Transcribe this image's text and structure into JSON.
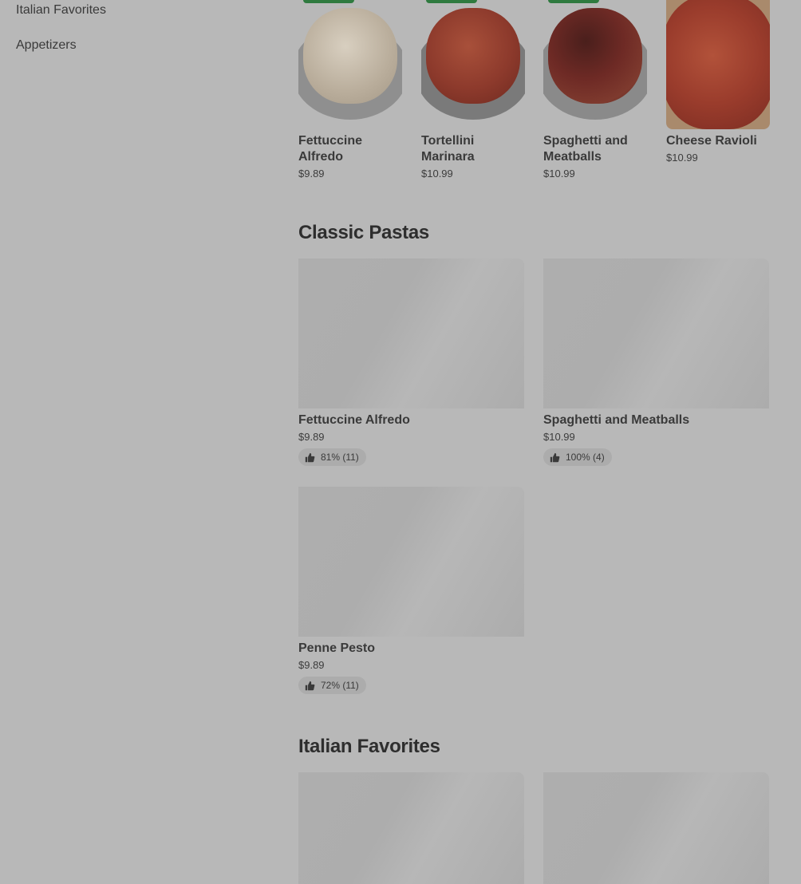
{
  "sidebar": {
    "items": [
      {
        "label": "Italian Favorites"
      },
      {
        "label": "Appetizers"
      }
    ]
  },
  "featured": {
    "items": [
      {
        "name": "Fettuccine Alfredo",
        "price": "$9.89",
        "food_color": "#c9bfb0",
        "plate_color": "#8f8f8f"
      },
      {
        "name": "Tortellini Marinara",
        "price": "$10.99",
        "food_color": "#8d3a2c",
        "plate_color": "#7a7a7a"
      },
      {
        "name": "Spaghetti and Meatballs",
        "price": "$10.99",
        "food_color": "#6e2a25",
        "plate_color": "#8a8a8a"
      },
      {
        "name": "Cheese Ravioli",
        "price": "$10.99",
        "food_color": "#9a3c2c",
        "plate_color": "#a98a6c"
      }
    ]
  },
  "sections": [
    {
      "title": "Classic Pastas",
      "items": [
        {
          "name": "Fettuccine Alfredo",
          "price": "$9.89",
          "rating": "81% (11)"
        },
        {
          "name": "Spaghetti and Meatballs",
          "price": "$10.99",
          "rating": "100% (4)"
        },
        {
          "name": "Penne Pesto",
          "price": "$9.89",
          "rating": "72% (11)"
        }
      ]
    },
    {
      "title": "Italian Favorites",
      "items": []
    }
  ],
  "colors": {
    "overlay_bg": "#b8b8b8",
    "badge_green": "#2f7a3f"
  }
}
